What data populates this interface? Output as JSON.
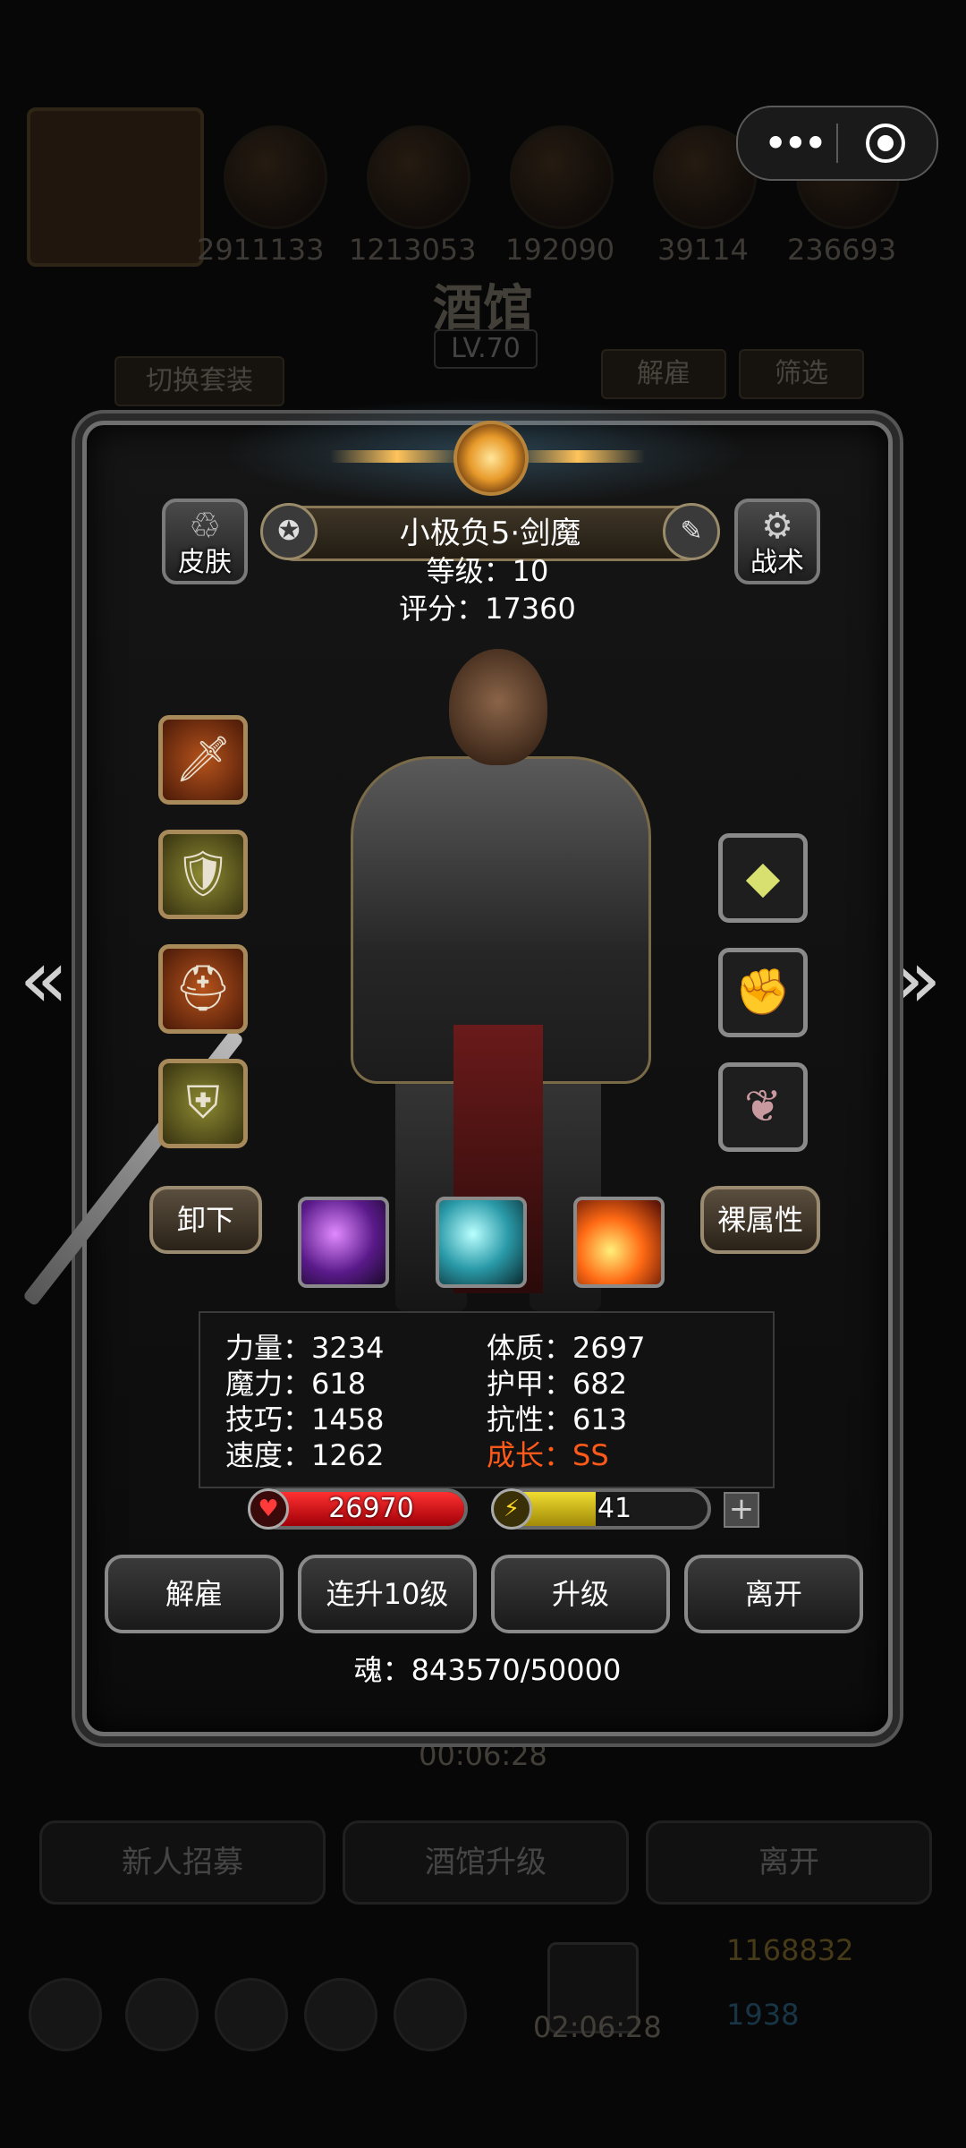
{
  "background": {
    "resource_numbers": [
      "2911133",
      "1213053",
      "192090",
      "39114",
      "236693"
    ],
    "title": "酒馆",
    "level": "LV.70",
    "switch_outfit_label": "切换套装",
    "dismiss_label": "解雇",
    "filter_label": "筛选",
    "timer": "00:06:28",
    "bottom_buttons": [
      "新人招募",
      "酒馆升级",
      "离开"
    ],
    "bottom_timer": "02:06:28",
    "gold": "1168832",
    "gems": "1938"
  },
  "capsule": {
    "more_icon": "more-dots-icon",
    "close_icon": "target-icon"
  },
  "hero": {
    "name": "小极负5·剑魔",
    "level_line": "等级：10",
    "score_line": "评分：17360",
    "skin_label": "皮肤",
    "tactics_label": "战术",
    "unequip_label": "卸下",
    "bare_attr_label": "裸属性"
  },
  "stats": {
    "strength": "力量：3234",
    "constitution": "体质：2697",
    "magic": "魔力：618",
    "armor": "护甲：682",
    "skill": "技巧：1458",
    "resistance": "抗性：613",
    "speed": "速度：1262",
    "growth": "成长：SS"
  },
  "bars": {
    "hp": "26970",
    "energy": "41",
    "energy_fill_fraction": 0.45
  },
  "actions": {
    "dismiss": "解雇",
    "level_up_10": "连升10级",
    "level_up": "升级",
    "leave": "离开"
  },
  "soul": "魂：843570/50000",
  "colors": {
    "growth": "#ff5a1a",
    "hp_bar": "#d8101a",
    "energy_bar": "#c8b414"
  }
}
